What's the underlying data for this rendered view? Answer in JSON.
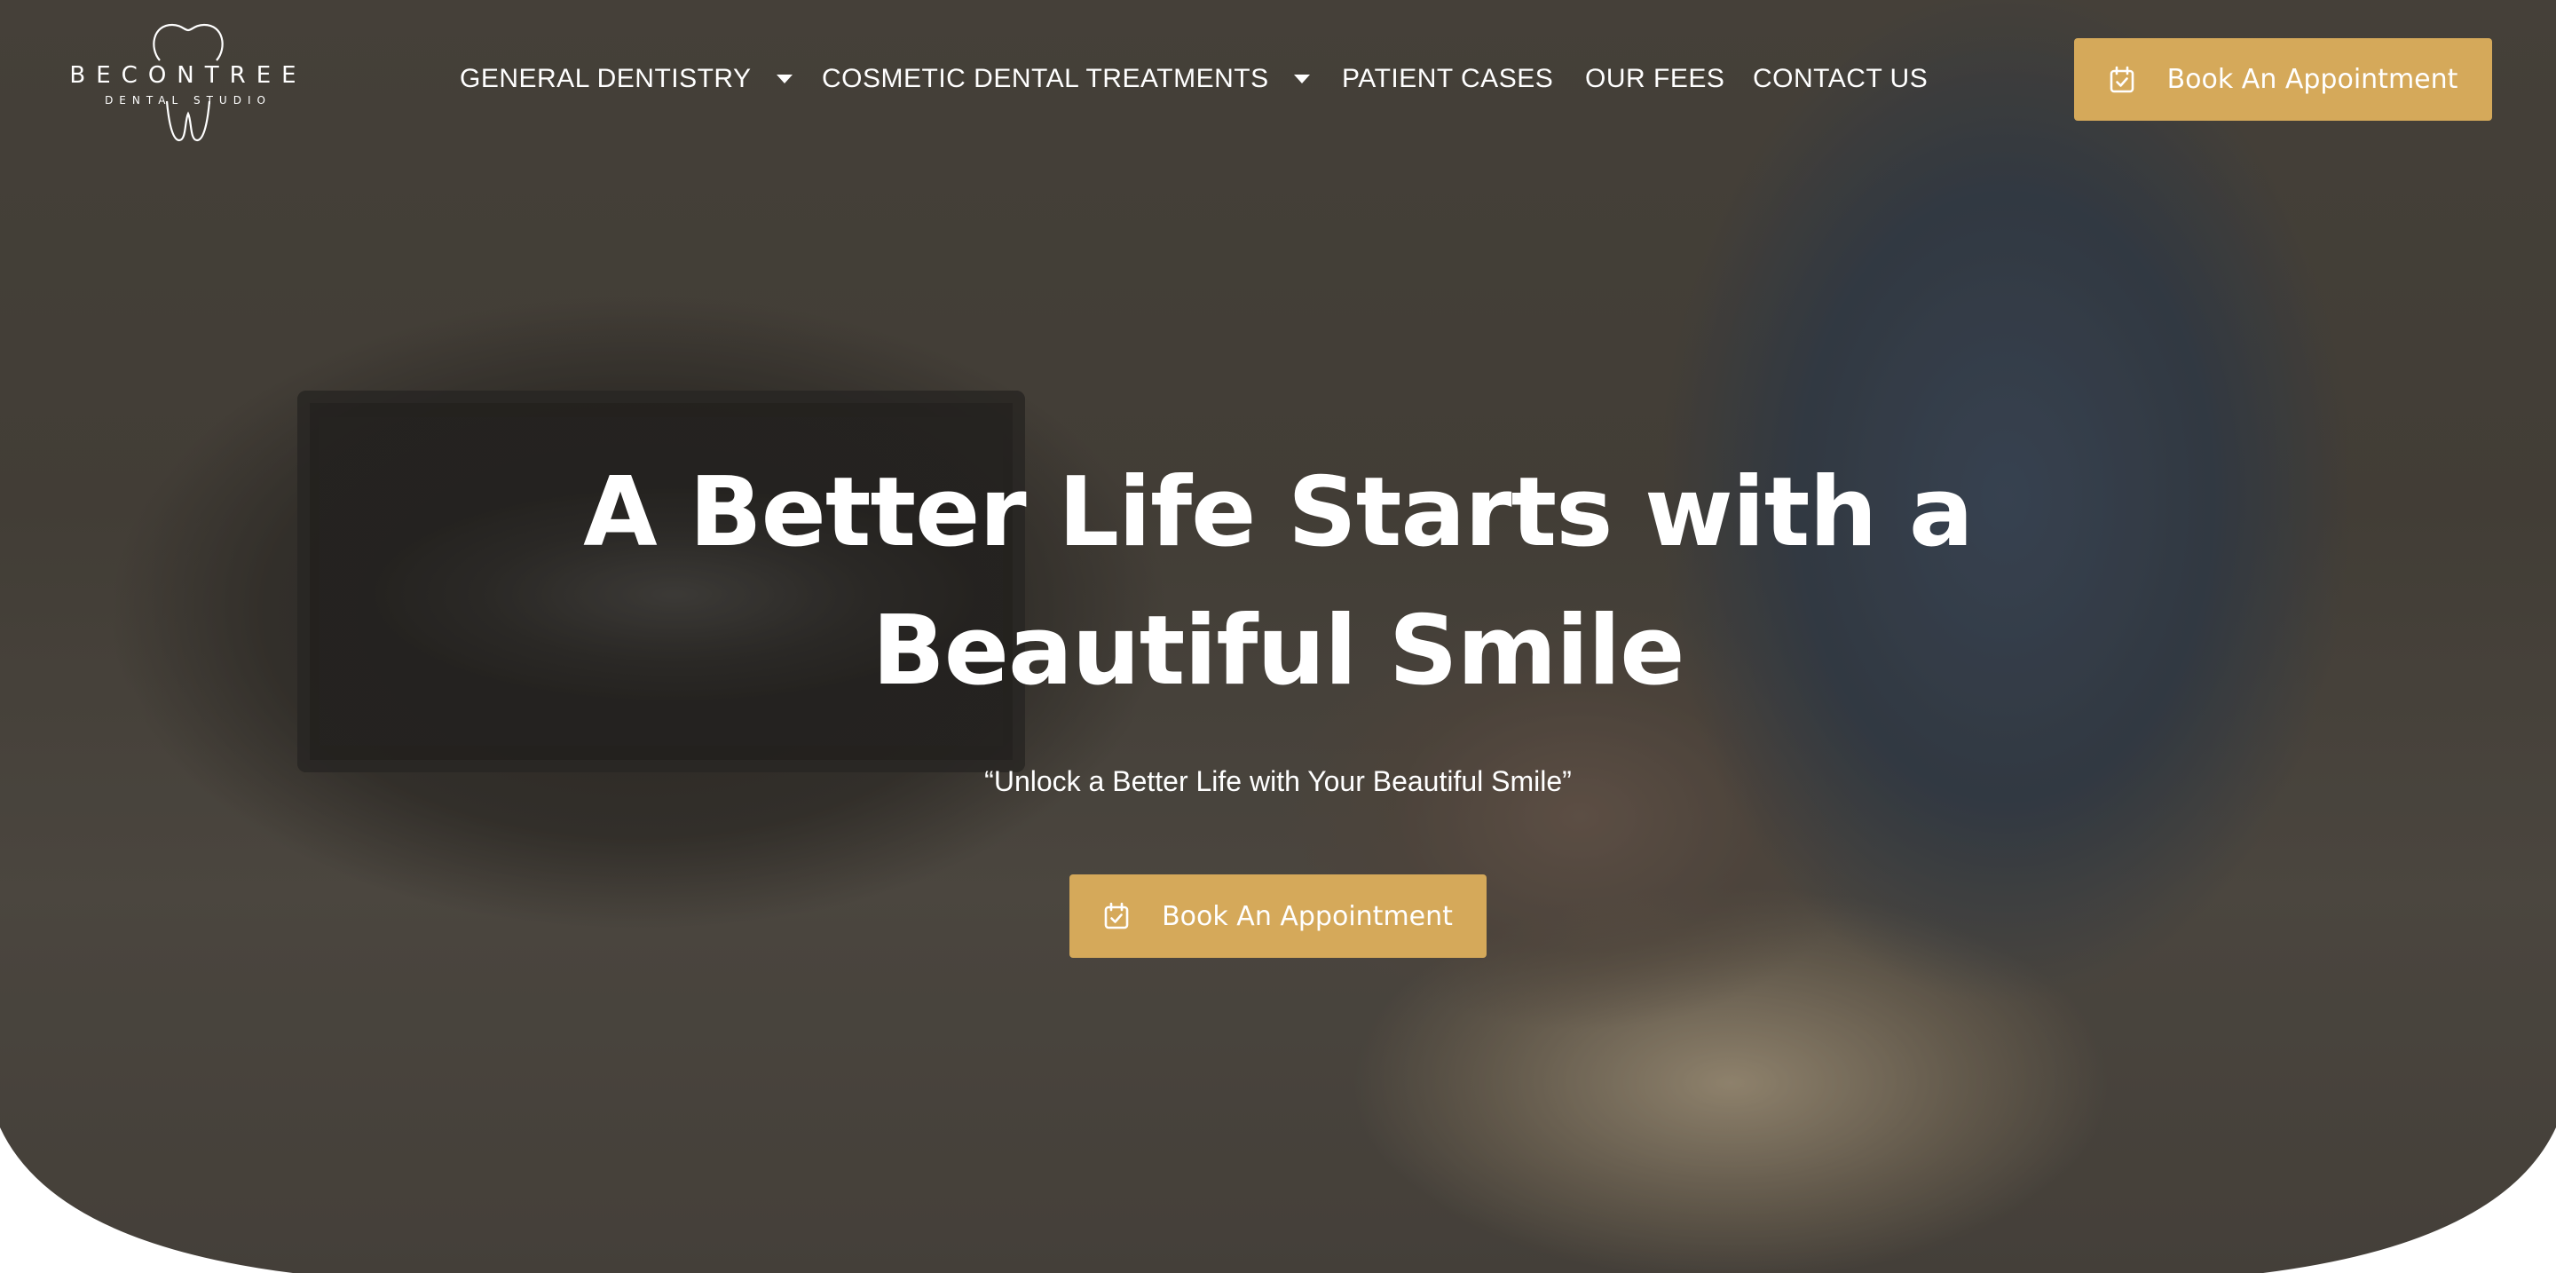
{
  "brand": {
    "name": "BECONTREE",
    "subtitle": "DENTAL STUDIO",
    "logo_icon": "tooth-outline-icon"
  },
  "nav": {
    "items": [
      {
        "label": "GENERAL DENTISTRY",
        "has_dropdown": true
      },
      {
        "label": "COSMETIC DENTAL TREATMENTS",
        "has_dropdown": true
      },
      {
        "label": "PATIENT CASES",
        "has_dropdown": false
      },
      {
        "label": "OUR FEES",
        "has_dropdown": false
      },
      {
        "label": "CONTACT US",
        "has_dropdown": false
      }
    ]
  },
  "header": {
    "cta_label": "Book An Appointment",
    "cta_icon": "calendar-check-icon"
  },
  "hero": {
    "headline_line1": "A Better Life Starts with a",
    "headline_line2": "Beautiful Smile",
    "tagline": "“Unlock a Better Life with Your Beautiful Smile”",
    "cta_label": "Book An Appointment",
    "cta_icon": "calendar-check-icon",
    "background": "dentist-treating-patient-photo"
  },
  "colors": {
    "accent": "#d5a95a",
    "text": "#ffffff",
    "page": "#ffffff"
  }
}
